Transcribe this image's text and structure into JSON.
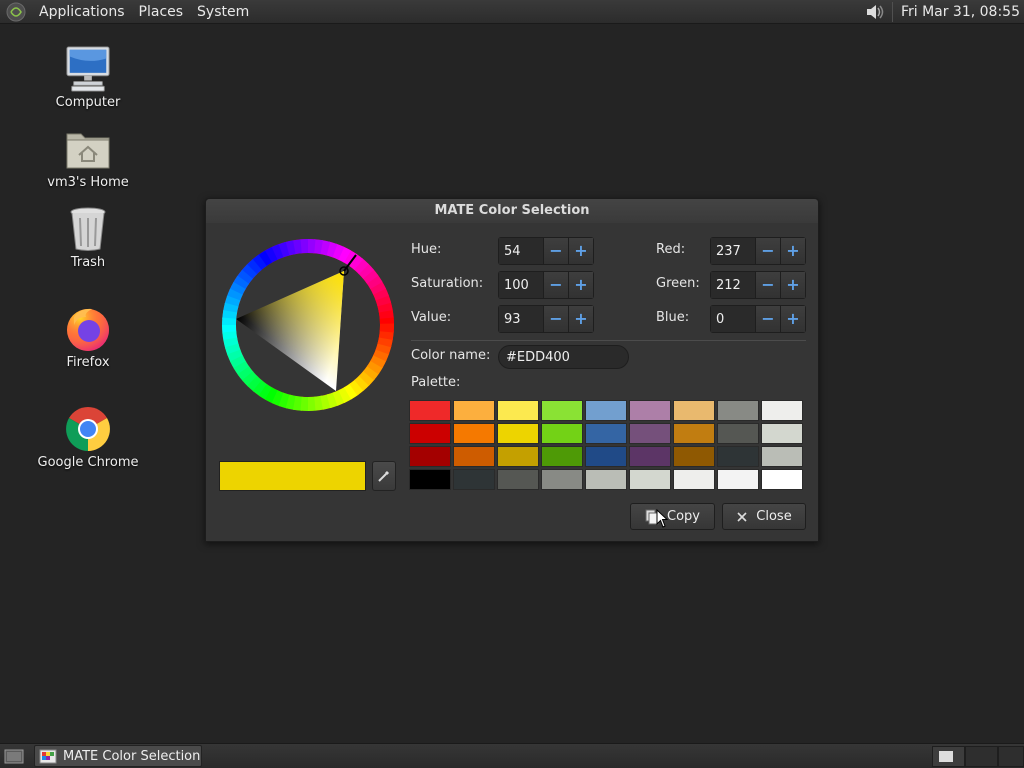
{
  "top_panel": {
    "menus": [
      "Applications",
      "Places",
      "System"
    ],
    "clock": "Fri Mar 31, 08:55"
  },
  "desktop_icons": [
    {
      "label": "Computer",
      "icon": "computer-icon"
    },
    {
      "label": "vm3's Home",
      "icon": "home-folder-icon"
    },
    {
      "label": "Trash",
      "icon": "trash-icon"
    },
    {
      "label": "Firefox",
      "icon": "firefox-icon"
    },
    {
      "label": "Google Chrome",
      "icon": "chrome-icon"
    }
  ],
  "dialog": {
    "title": "MATE Color Selection",
    "hue": {
      "label": "Hue:",
      "value": "54"
    },
    "saturation": {
      "label": "Saturation:",
      "value": "100"
    },
    "value": {
      "label": "Value:",
      "value": "93"
    },
    "red": {
      "label": "Red:",
      "value": "237"
    },
    "green": {
      "label": "Green:",
      "value": "212"
    },
    "blue": {
      "label": "Blue:",
      "value": "0"
    },
    "color_name": {
      "label": "Color name:",
      "value": "#EDD400"
    },
    "palette_label": "Palette:",
    "current_color": "#EDD400",
    "palette": [
      [
        "#ef2929",
        "#fcaf3e",
        "#fce94f",
        "#8ae234",
        "#729fcf",
        "#ad7fa8",
        "#e9b96e",
        "#888a85",
        "#eeeeec"
      ],
      [
        "#cc0000",
        "#f57900",
        "#edd400",
        "#73d216",
        "#3465a4",
        "#75507b",
        "#c17d11",
        "#555753",
        "#d3d7cf"
      ],
      [
        "#a40000",
        "#ce5c00",
        "#c4a000",
        "#4e9a06",
        "#204a87",
        "#5c3566",
        "#8f5902",
        "#2e3436",
        "#babdb6"
      ],
      [
        "#000000",
        "#2e3436",
        "#555753",
        "#888a85",
        "#babdb6",
        "#d3d7cf",
        "#eeeeec",
        "#f3f3f3",
        "#ffffff"
      ]
    ],
    "copy_label": "Copy",
    "close_label": "Close"
  },
  "bottom_panel": {
    "task_label": "MATE Color Selection"
  }
}
